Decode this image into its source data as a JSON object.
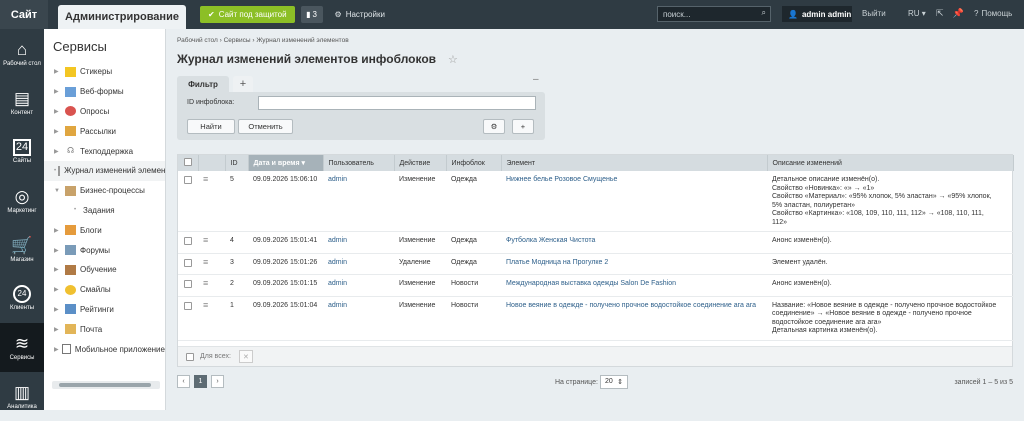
{
  "topbar": {
    "site_tab": "Сайт",
    "admin_tab": "Администрирование",
    "protection_button": "Сайт под защитой",
    "count_badge": "3",
    "settings_label": "Настройки",
    "search_placeholder": "поиск...",
    "user_name": "admin admin",
    "exit_label": "Выйти",
    "language": "RU",
    "help_label": "Помощь"
  },
  "leftbar": {
    "items": [
      {
        "label": "Рабочий стол",
        "icon": "home-icon"
      },
      {
        "label": "Контент",
        "icon": "document-icon"
      },
      {
        "label": "Сайты",
        "icon": "calendar-icon"
      },
      {
        "label": "Маркетинг",
        "icon": "target-icon"
      },
      {
        "label": "Магазин",
        "icon": "cart-icon"
      },
      {
        "label": "Клиенты",
        "icon": "clock-icon"
      },
      {
        "label": "Сервисы",
        "icon": "layers-icon"
      },
      {
        "label": "Аналитика",
        "icon": "chart-icon"
      }
    ],
    "calendar_day": "24",
    "clients_day": "24"
  },
  "sidebar": {
    "title": "Сервисы",
    "items": [
      {
        "label": "Стикеры"
      },
      {
        "label": "Веб-формы"
      },
      {
        "label": "Опросы"
      },
      {
        "label": "Рассылки"
      },
      {
        "label": "Техподдержка"
      },
      {
        "label": "Журнал изменений элементов"
      },
      {
        "label": "Бизнес-процессы"
      },
      {
        "label": "Задания"
      },
      {
        "label": "Блоги"
      },
      {
        "label": "Форумы"
      },
      {
        "label": "Обучение"
      },
      {
        "label": "Смайлы"
      },
      {
        "label": "Рейтинги"
      },
      {
        "label": "Почта"
      },
      {
        "label": "Мобильное приложение"
      }
    ]
  },
  "breadcrumb": {
    "items": [
      "Рабочий стол",
      "Сервисы",
      "Журнал изменений элементов"
    ]
  },
  "page": {
    "title": "Журнал изменений элементов инфоблоков"
  },
  "filter": {
    "tab_label": "Фильтр",
    "add_label": "+",
    "collapse_label": "–",
    "iblock_label": "ID инфоблока:",
    "iblock_value": "",
    "find_button": "Найти",
    "cancel_button": "Отменить",
    "plus_label": "+"
  },
  "table": {
    "headers": [
      "ID",
      "Дата и время",
      "Пользователь",
      "Действие",
      "Инфоблок",
      "Элемент",
      "Описание изменений"
    ],
    "rows": [
      {
        "id": "5",
        "date": "09.09.2026 15:06:10",
        "user": "admin",
        "action": "Изменение",
        "iblock": "Одежда",
        "element": "Нижнее белье Розовое Смущенье",
        "desc": [
          "Детальное описание изменён(о).",
          "Свойство «Новинка»: «» → «1»",
          "Свойство «Материал»: «95% хлопок, 5% эластан» → «95% хлопок,",
          "5% эластан, полиуретан»",
          "Свойство «Картинка»: «108, 109, 110, 111, 112» → «108, 110, 111,",
          "112»"
        ]
      },
      {
        "id": "4",
        "date": "09.09.2026 15:01:41",
        "user": "admin",
        "action": "Изменение",
        "iblock": "Одежда",
        "element": "Футболка Женская Чистота",
        "desc": [
          "Анонс изменён(о)."
        ]
      },
      {
        "id": "3",
        "date": "09.09.2026 15:01:26",
        "user": "admin",
        "action": "Удаление",
        "iblock": "Одежда",
        "element": "Платье Модница на Прогулке 2",
        "desc": [
          "Элемент удалён."
        ]
      },
      {
        "id": "2",
        "date": "09.09.2026 15:01:15",
        "user": "admin",
        "action": "Изменение",
        "iblock": "Новости",
        "element": "Международная выставка одежды Salon De Fashion",
        "desc": [
          "Анонс изменён(о)."
        ]
      },
      {
        "id": "1",
        "date": "09.09.2026 15:01:04",
        "user": "admin",
        "action": "Изменение",
        "iblock": "Новости",
        "element": "Новое веяние в одежде - получено прочное водостойкое соединение ага ага",
        "desc": [
          "Название: «Новое веяние в одежде - получено прочное водостойкое",
          "соединение» → «Новое веяние в одежде - получено прочное",
          "водостойкое соединение ага ага»",
          "Детальная картинка изменён(о)."
        ]
      }
    ],
    "for_all_label": "Для всех:"
  },
  "pager": {
    "prev": "‹",
    "current": "1",
    "next": "›",
    "per_page_label": "На странице:",
    "per_page_value": "20",
    "records_label": "записей 1 – 5 из 5"
  },
  "colors": {
    "topbar": "#2f3b43",
    "accent_green": "#8cbf26",
    "link": "#2d5f8a",
    "sorted_header": "#a6b2b9"
  }
}
